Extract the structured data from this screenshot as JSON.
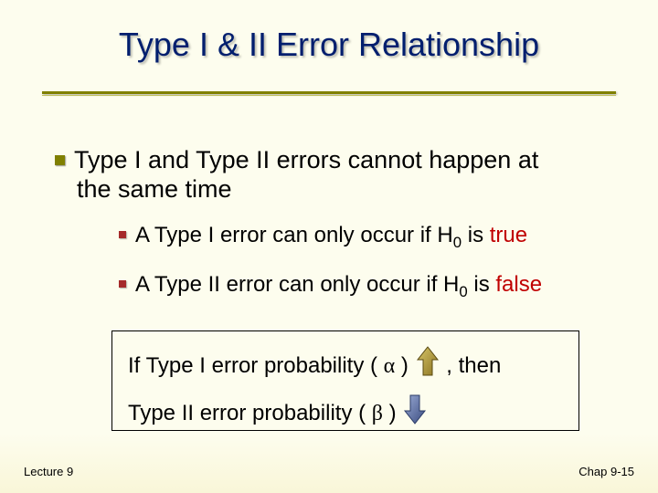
{
  "title": "Type I & II Error Relationship",
  "bullets": {
    "lvl1_line1": "Type I and Type II errors cannot happen at",
    "lvl1_line2": "the same time",
    "lvl2_a_pre": "A Type I error can only occur if H",
    "lvl2_a_sub": "0",
    "lvl2_a_mid": " is ",
    "lvl2_a_kw": "true",
    "lvl2_b_pre": "A Type II error can only occur if H",
    "lvl2_b_sub": "0",
    "lvl2_b_mid": " is ",
    "lvl2_b_kw": "false"
  },
  "box": {
    "line1_pre": "If Type I error probability ( ",
    "alpha": "α",
    "line1_post": " ) ",
    "line1_end": " , then",
    "line2_pre": "Type II error probability ( ",
    "beta": "β",
    "line2_post": " ) "
  },
  "footer": {
    "left": "Lecture 9",
    "right": "Chap 9-15"
  },
  "colors": {
    "arrow_up_fill": "#a88b2a",
    "arrow_up_stroke": "#5a4a12",
    "arrow_down_fill": "#5a6ea0",
    "arrow_down_stroke": "#2a3a66"
  }
}
